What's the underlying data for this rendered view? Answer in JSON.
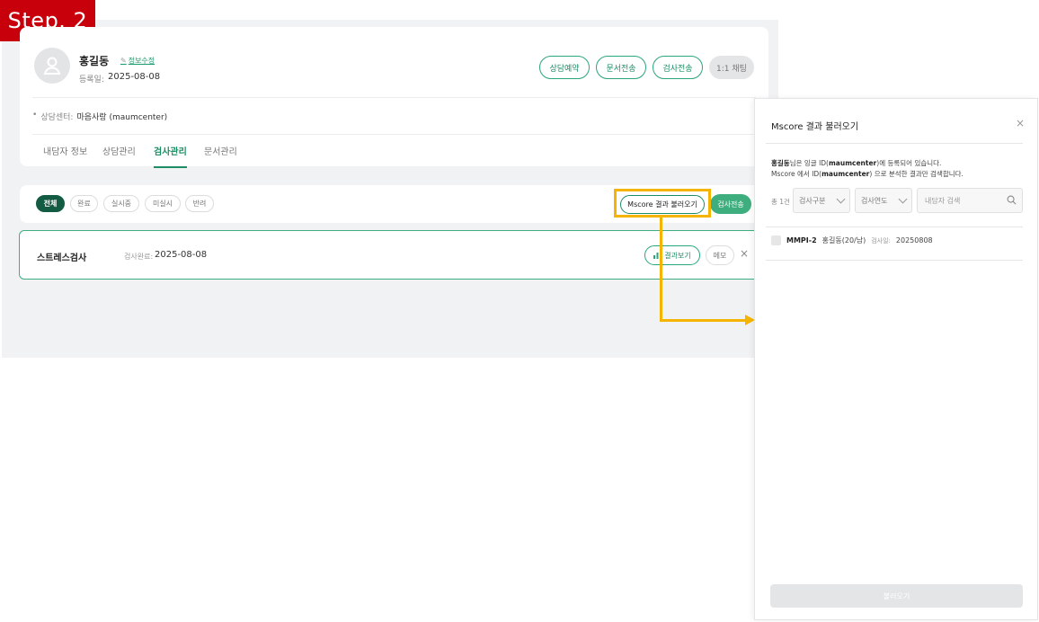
{
  "step_badge": "Step. 2",
  "profile": {
    "name": "홍길동",
    "edit_link": "정보수정",
    "reg_label": "등록일:",
    "reg_date": "2025-08-08",
    "center_label": "상담센터:",
    "center_value": "마음사랑 (maumcenter)"
  },
  "actions": {
    "consult": "상담예약",
    "doc_send": "문서전송",
    "test_send": "검사전송",
    "chat": "1:1 채팅"
  },
  "tabs": [
    "내담자 정보",
    "상담관리",
    "검사관리",
    "문서관리"
  ],
  "active_tab": "검사관리",
  "filters": [
    "전체",
    "완료",
    "실시중",
    "미실시",
    "반려"
  ],
  "mscore_button": "Mscore 결과 불러오기",
  "send_test_button": "검사전송",
  "test_row": {
    "name": "스트레스검사",
    "date_label": "검사완료:",
    "date": "2025-08-08",
    "result_button": "결과보기",
    "memo_button": "메모",
    "close": "×"
  },
  "modal": {
    "title": "Mscore 결과 불러오기",
    "close": "×",
    "desc_name": "홍길동",
    "desc_line1_rest": "님은 잉글 ID(",
    "desc_id": "maumcenter",
    "desc_line1_end": ")에 등록되어 있습니다.",
    "desc_line2_a": "Mscore 에서 ID(",
    "desc_line2_end": ") 으로 분석한 결과만 검색합니다.",
    "total": "총 1건",
    "select_type": "검사구분",
    "select_year": "검사연도",
    "search_placeholder": "내담자 검색",
    "result": {
      "test": "MMPI-2",
      "client": "홍길동(20/남)",
      "date_label": "검사일:",
      "date": "20250808"
    },
    "load_button": "불러오기"
  },
  "colors": {
    "accent": "#1d8e64",
    "highlight": "#f4b400",
    "badge": "#c8000b"
  }
}
